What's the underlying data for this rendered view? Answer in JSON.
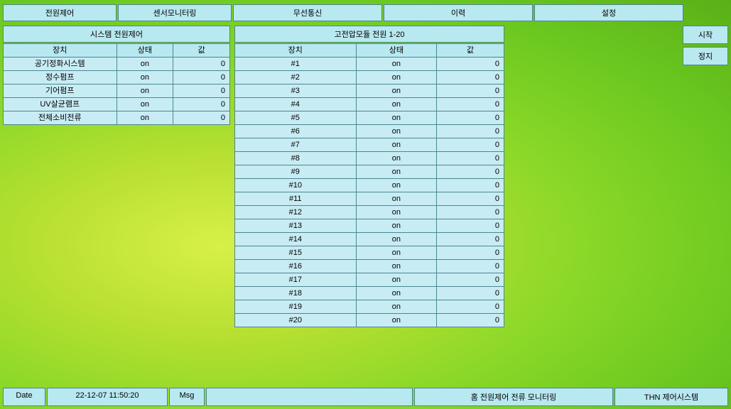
{
  "tabs": {
    "t1": "전원제어",
    "t2": "센서모니터링",
    "t3": "무선통신",
    "t4": "이력",
    "t5": "설정"
  },
  "side_buttons": {
    "start": "시작",
    "stop": "정지"
  },
  "left_panel": {
    "title": "시스템 전원제어",
    "headers": {
      "device": "장치",
      "state": "상태",
      "value": "값"
    },
    "rows": [
      {
        "device": "공기정화시스템",
        "state": "on",
        "value": "0"
      },
      {
        "device": "정수펌프",
        "state": "on",
        "value": "0"
      },
      {
        "device": "기어펌프",
        "state": "on",
        "value": "0"
      },
      {
        "device": "UV살균램프",
        "state": "on",
        "value": "0"
      },
      {
        "device": "전체소비전류",
        "state": "on",
        "value": "0"
      }
    ]
  },
  "right_panel": {
    "title": "고전압모듈 전원 1-20",
    "headers": {
      "device": "장치",
      "state": "상태",
      "value": "값"
    },
    "rows": [
      {
        "device": "#1",
        "state": "on",
        "value": "0"
      },
      {
        "device": "#2",
        "state": "on",
        "value": "0"
      },
      {
        "device": "#3",
        "state": "on",
        "value": "0"
      },
      {
        "device": "#4",
        "state": "on",
        "value": "0"
      },
      {
        "device": "#5",
        "state": "on",
        "value": "0"
      },
      {
        "device": "#6",
        "state": "on",
        "value": "0"
      },
      {
        "device": "#7",
        "state": "on",
        "value": "0"
      },
      {
        "device": "#8",
        "state": "on",
        "value": "0"
      },
      {
        "device": "#9",
        "state": "on",
        "value": "0"
      },
      {
        "device": "#10",
        "state": "on",
        "value": "0"
      },
      {
        "device": "#11",
        "state": "on",
        "value": "0"
      },
      {
        "device": "#12",
        "state": "on",
        "value": "0"
      },
      {
        "device": "#13",
        "state": "on",
        "value": "0"
      },
      {
        "device": "#14",
        "state": "on",
        "value": "0"
      },
      {
        "device": "#15",
        "state": "on",
        "value": "0"
      },
      {
        "device": "#16",
        "state": "on",
        "value": "0"
      },
      {
        "device": "#17",
        "state": "on",
        "value": "0"
      },
      {
        "device": "#18",
        "state": "on",
        "value": "0"
      },
      {
        "device": "#19",
        "state": "on",
        "value": "0"
      },
      {
        "device": "#20",
        "state": "on",
        "value": "0"
      }
    ]
  },
  "status_bar": {
    "date_label": "Date",
    "date_value": "22-12-07 11:50:20",
    "msg_label": "Msg",
    "msg_value": "",
    "center_title": "홈 전원제어 전류 모니터링",
    "company": "THN 제어시스템"
  }
}
